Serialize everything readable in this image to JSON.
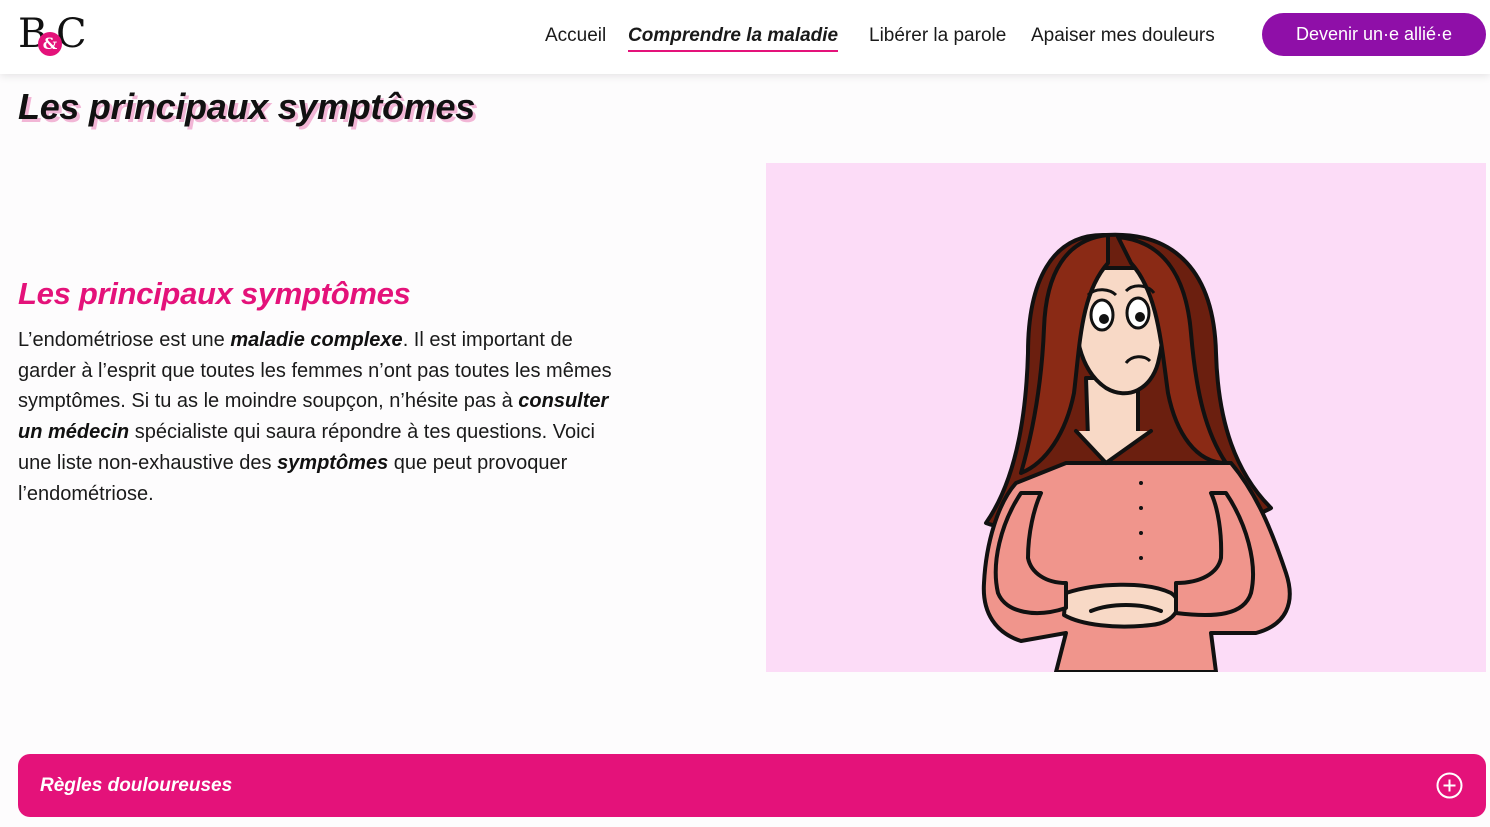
{
  "header": {
    "logo": {
      "letter_left": "B",
      "ampersand": "&",
      "letter_right": "C"
    },
    "nav": [
      {
        "label": "Accueil",
        "active": false
      },
      {
        "label": "Comprendre la maladie",
        "active": true
      },
      {
        "label": "Libérer la parole",
        "active": false
      },
      {
        "label": "Apaiser mes douleurs",
        "active": false
      }
    ],
    "cta_label": "Devenir un·e allié·e"
  },
  "page_title": "Les principaux symptômes",
  "section": {
    "title": "Les principaux symptômes",
    "body": [
      {
        "text": "L’endométriose est une ",
        "bold": false
      },
      {
        "text": "maladie complexe",
        "bold": true
      },
      {
        "text": ". Il est important de garder à l’esprit que toutes les femmes n’ont pas toutes les mêmes symptômes. Si tu as le moindre soupçon, n’hésite pas à ",
        "bold": false
      },
      {
        "text": "consulter un médecin",
        "bold": true
      },
      {
        "text": " spécialiste qui saura répondre à tes questions. Voici une liste non-exhaustive des ",
        "bold": false
      },
      {
        "text": "symptômes",
        "bold": true
      },
      {
        "text": " que peut provoquer l’endométriose.",
        "bold": false
      }
    ]
  },
  "accordion": {
    "label": "Règles douloureuses",
    "icon": "plus-circle-icon"
  },
  "colors": {
    "accent_pink": "#e4127a",
    "cta_purple": "#8f0fa8",
    "illustration_bg": "#fcdcf7"
  }
}
